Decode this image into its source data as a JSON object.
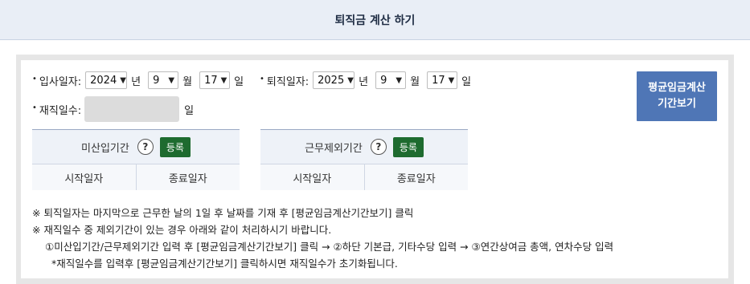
{
  "header": {
    "title": "퇴직금 계산 하기"
  },
  "join": {
    "label": "입사일자:",
    "year": "2024",
    "year_unit": "년",
    "month": "9",
    "month_unit": "월",
    "day": "17",
    "day_unit": "일"
  },
  "leave": {
    "label": "퇴직일자:",
    "year": "2025",
    "year_unit": "년",
    "month": "9",
    "month_unit": "월",
    "day": "17",
    "day_unit": "일"
  },
  "tenure": {
    "label": "재직일수:",
    "value": "",
    "unit": "일"
  },
  "calc_button": {
    "line1": "평균임금계산",
    "line2": "기간보기"
  },
  "unpaid_period": {
    "title": "미산입기간",
    "help": "?",
    "register": "등록",
    "start_label": "시작일자",
    "end_label": "종료일자"
  },
  "excluded_period": {
    "title": "근무제외기간",
    "help": "?",
    "register": "등록",
    "start_label": "시작일자",
    "end_label": "종료일자"
  },
  "notes": {
    "line1": "※ 퇴직일자는 마지막으로 근무한 날의 1일 후 날짜를 기재 후 [평균임금계산기간보기] 클릭",
    "line2": "※ 재직일수 중 제외기간이 있는 경우 아래와 같이 처리하시기 바랍니다.",
    "line3": "①미산입기간/근무제외기간 입력 후 [평균임금계산기간보기] 클릭 → ②하단 기본급, 기타수당 입력 → ③연간상여금 총액, 연차수당 입력",
    "line4": "*재직일수를 입력후 [평균임금계산기간보기] 클릭하시면 재직일수가 초기화됩니다."
  },
  "colors": {
    "button_blue": "#4f76b6",
    "register_green": "#1e6b2f",
    "header_bg": "#e9eef6"
  },
  "icons": {
    "dropdown": "chevron-down-icon",
    "help": "question-circle-icon"
  }
}
